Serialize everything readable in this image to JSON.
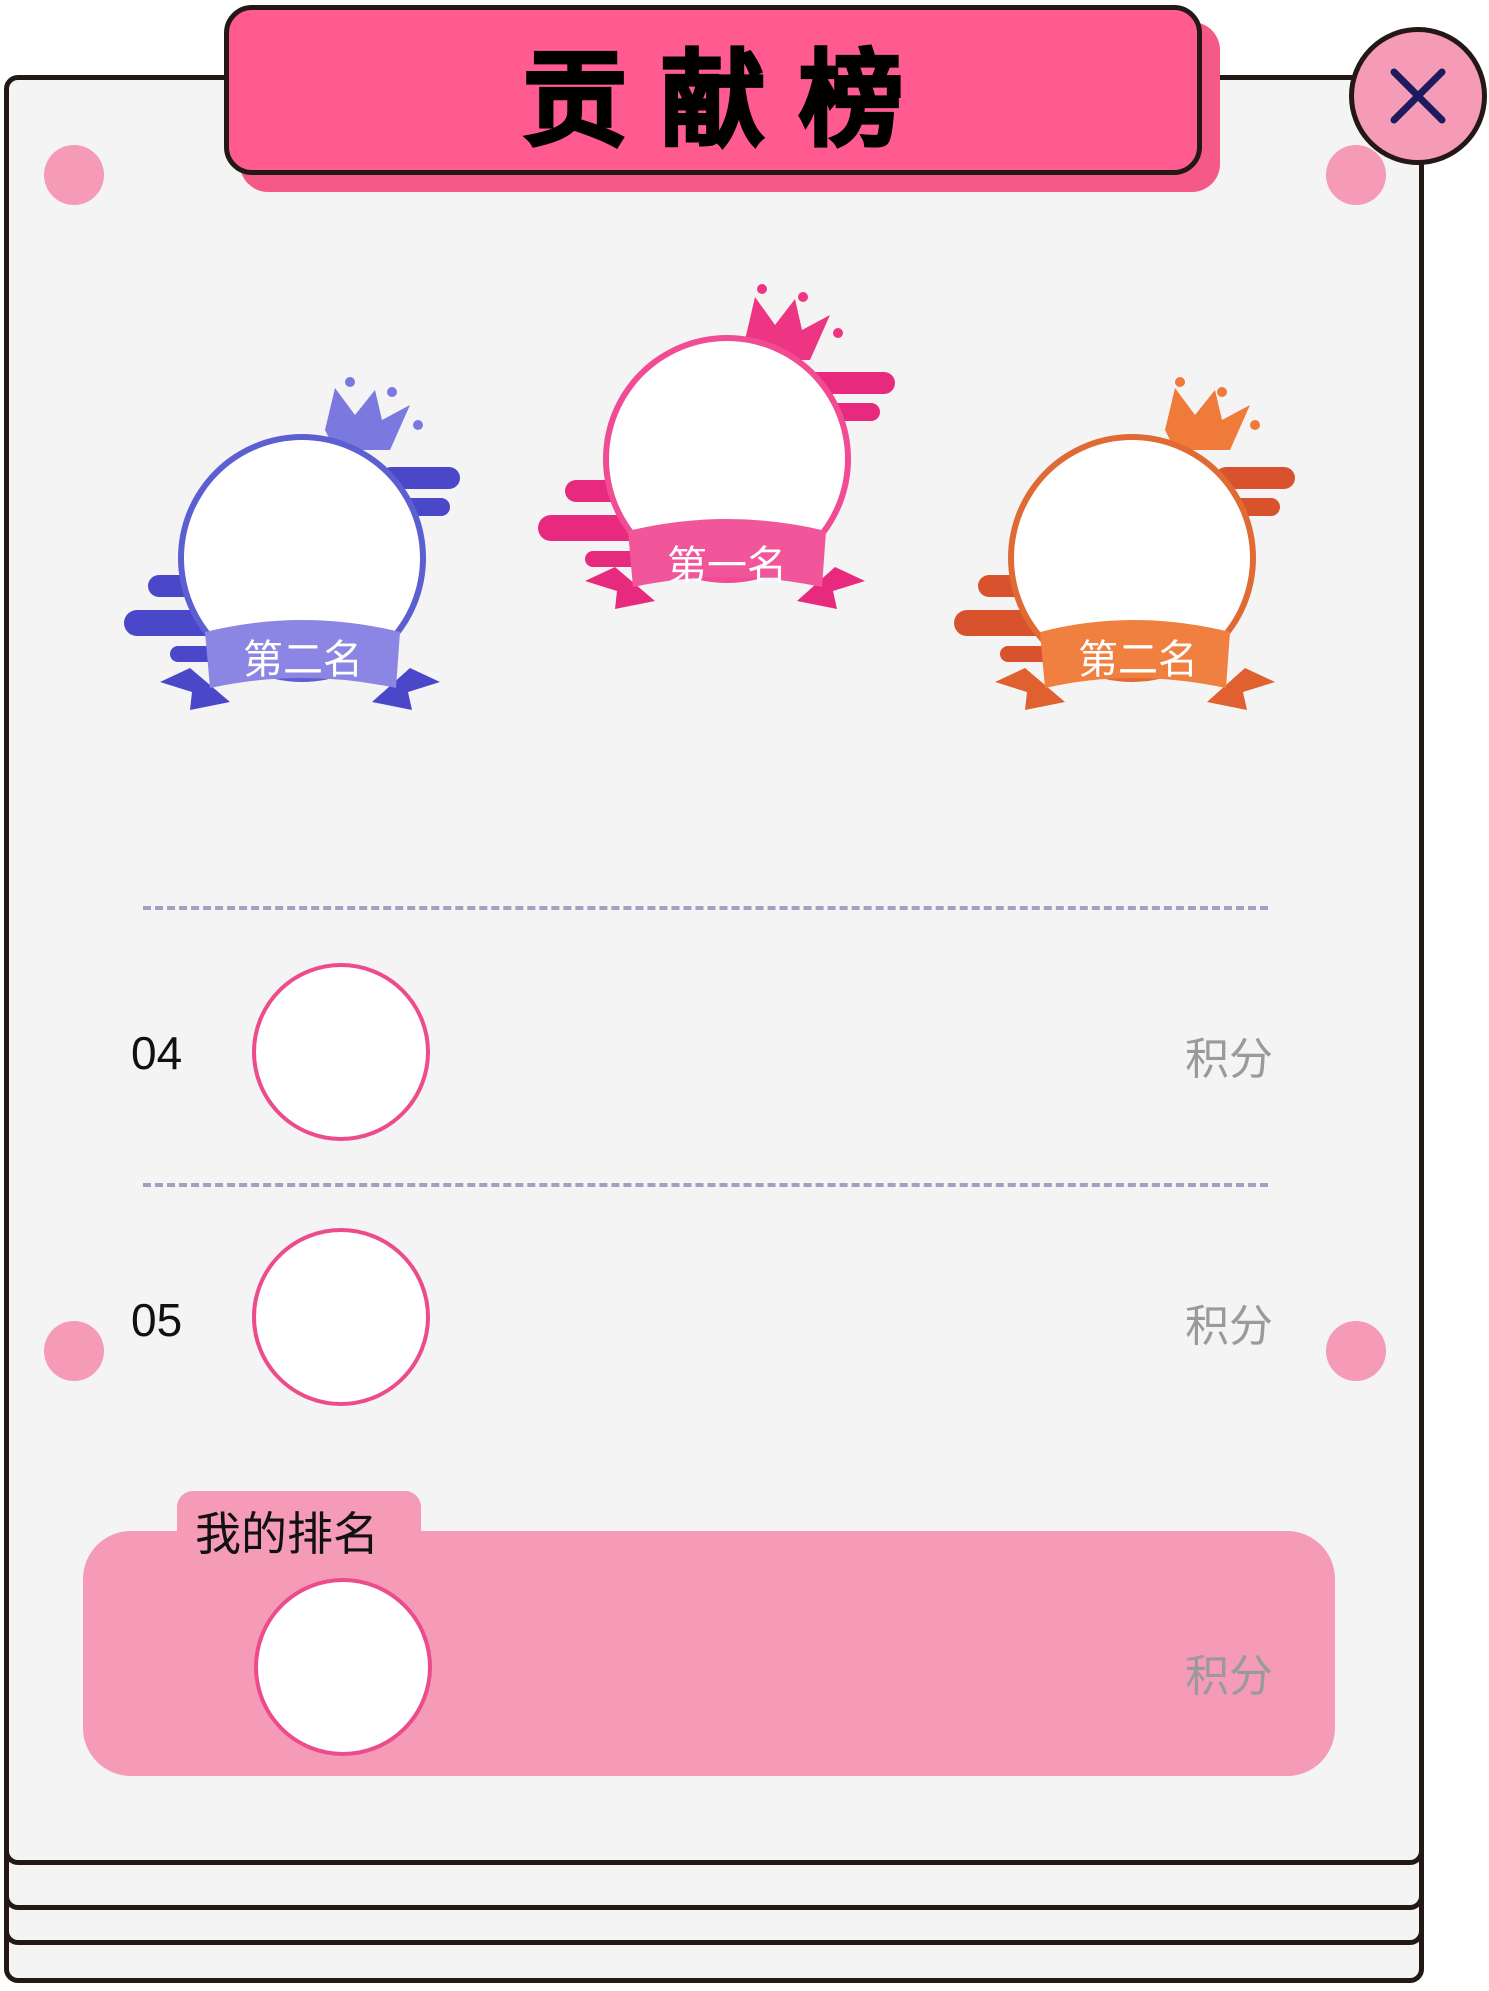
{
  "header": {
    "title": "贡献榜"
  },
  "close_button": {
    "icon": "close-icon"
  },
  "podium": [
    {
      "rank_label": "第二名",
      "theme": "#5b5fd1",
      "position": "left"
    },
    {
      "rank_label": "第一名",
      "theme": "#ec3f8a",
      "position": "center"
    },
    {
      "rank_label": "第二名",
      "theme": "#ef7a3b",
      "position": "right"
    }
  ],
  "list": [
    {
      "rank": "04",
      "score_label": "积分"
    },
    {
      "rank": "05",
      "score_label": "积分"
    }
  ],
  "my_rank": {
    "label": "我的排名",
    "score_label": "积分"
  },
  "colors": {
    "accent": "#ff5b91",
    "panel": "#f59bb7",
    "divider": "#a3a1c1",
    "border": "#231815"
  }
}
